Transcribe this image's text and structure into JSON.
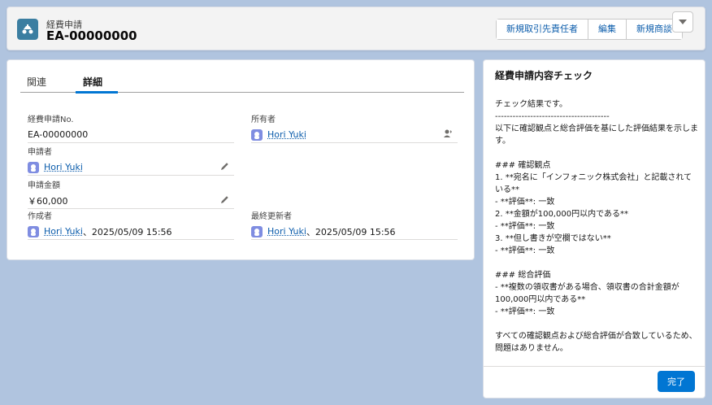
{
  "header": {
    "object_type": "経費申請",
    "record_name": "EA-00000000",
    "buttons": [
      "新規取引先責任者",
      "編集",
      "新規商談"
    ]
  },
  "tabs": [
    {
      "label": "関連",
      "active": false
    },
    {
      "label": "詳細",
      "active": true
    }
  ],
  "fields": {
    "expense_no": {
      "label": "経費申請No.",
      "value": "EA-00000000"
    },
    "owner": {
      "label": "所有者",
      "value": "Hori Yuki"
    },
    "applicant": {
      "label": "申請者",
      "value": "Hori Yuki"
    },
    "amount": {
      "label": "申請金額",
      "value": "￥60,000"
    },
    "created_by": {
      "label": "作成者",
      "user": "Hori Yuki",
      "date": "、2025/05/09 15:56"
    },
    "modified_by": {
      "label": "最終更新者",
      "user": "Hori Yuki",
      "date": "、2025/05/09 15:56"
    }
  },
  "panel": {
    "title": "経費申請内容チェック",
    "body": "チェック結果です。\n---------------------------------------\n以下に確認観点と総合評価を基にした評価結果を示します。\n\n### 確認観点\n1. **宛名に「インフォニック株式会社」と記載されている**\n- **評価**: 一致\n2. **金額が100,000円以内である**\n- **評価**: 一致\n3. **但し書きが空欄ではない**\n- **評価**: 一致\n\n### 総合評価\n- **複数の領収書がある場合、領収書の合計金額が100,000円以内である**\n- **評価**: 一致\n\nすべての確認観点および総合評価が合致しているため、問題はありません。",
    "done_label": "完了"
  },
  "colors": {
    "brand_blue": "#0176d3",
    "object_icon": "#3b7ea1",
    "background": "#b0c4df"
  }
}
